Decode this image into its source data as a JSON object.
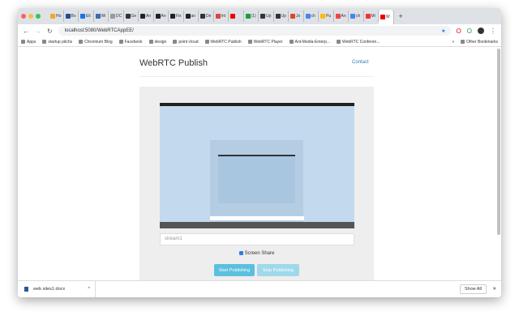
{
  "browser": {
    "tabs": [
      "Ho",
      "Bo",
      "Eli",
      "Wi",
      "DC",
      "Ge",
      "An",
      "An",
      "Fix",
      "an",
      "De",
      "Int",
      "",
      "(1)",
      "Up",
      "Up",
      "Jo",
      "ch",
      "Pu",
      "An",
      "ch",
      "Mi",
      "W"
    ],
    "new_tab": "+",
    "url": "localhost:5080/WebRTCAppEE/",
    "bookmarks": [
      "Apps",
      "startup pitchs",
      "Chromium Blog",
      "Facebook",
      "design",
      "point cloud",
      "WebRTC Publish",
      "WebRTC Player",
      "Ant-Media-Enterp...",
      "WebRTC Conferen..."
    ],
    "more_bookmarks": "»",
    "other_bookmarks": "Other Bookmarks"
  },
  "page": {
    "title": "WebRTC Publish",
    "contact": "Contact",
    "stream_input_value": "stream1",
    "screen_share_label": "Screen Share",
    "start_button": "Start Publishing",
    "stop_button": "Stop Publishing"
  },
  "downloads": {
    "file": "web sites1.docx",
    "show_all": "Show All",
    "close": "✕"
  }
}
